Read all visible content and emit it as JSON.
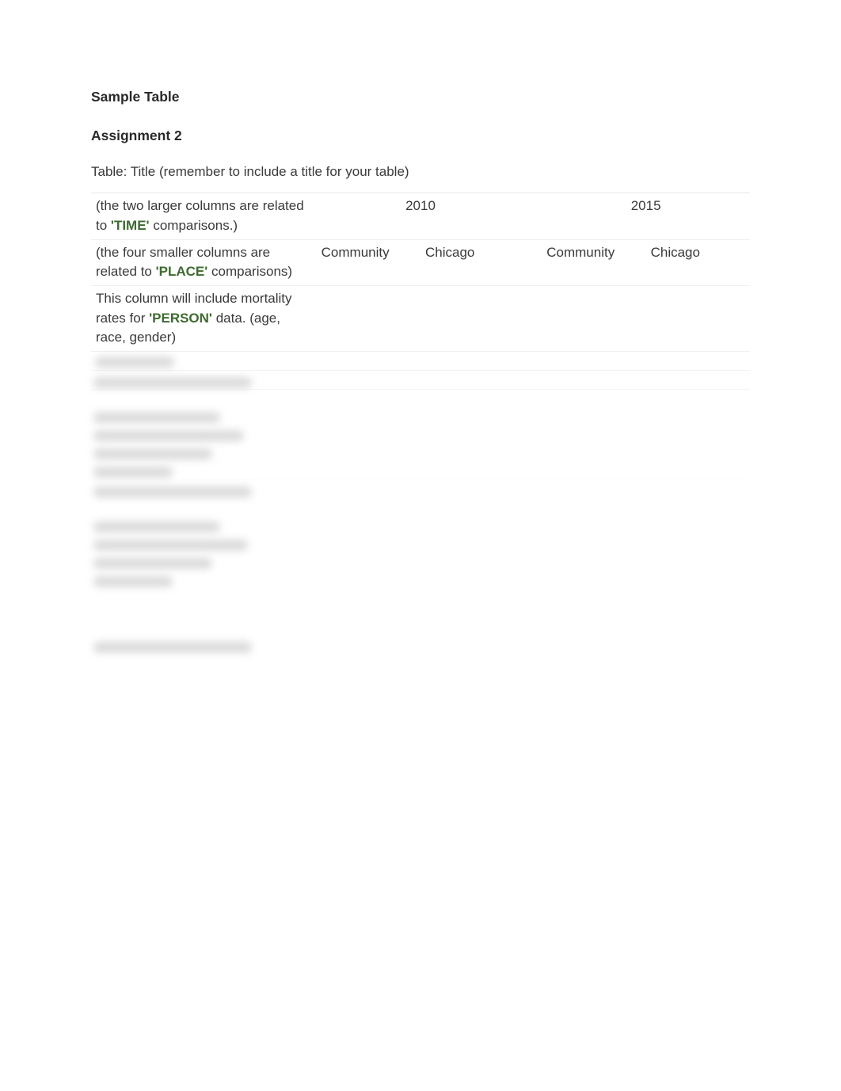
{
  "headings": {
    "sample_table": "Sample Table",
    "assignment": "Assignment 2"
  },
  "caption": "Table: Title (remember to include a title for your table)",
  "keywords": {
    "time": "'TIME'",
    "place": "'PLACE'",
    "person": "'PERSON'"
  },
  "row1": {
    "pre": "(the two larger columns are related to ",
    "post": " comparisons.)"
  },
  "row2": {
    "pre": "(the four smaller columns are related to ",
    "post": " comparisons)"
  },
  "row3": {
    "pre": "This column will include mortality rates for ",
    "post": " data. (age, race, gender)"
  },
  "years": {
    "y2010": "2010",
    "y2015": "2015"
  },
  "subcols": {
    "community_a": "Community",
    "chicago_a": "Chicago",
    "community_b": "Community",
    "chicago_b": "Chicago"
  }
}
